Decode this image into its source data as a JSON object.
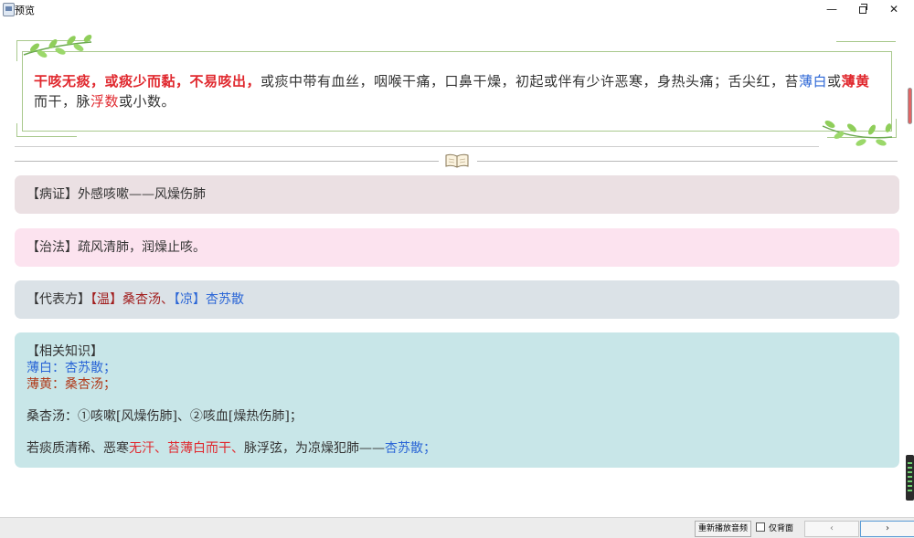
{
  "window": {
    "title": "预览",
    "minimize_glyph": "—",
    "close_glyph": "✕"
  },
  "symptoms": {
    "seg1": "干咳无痰，或痰少而黏，不易咳出，",
    "seg2": "或痰中带有血丝，咽喉干痛，口鼻干燥，初起或伴有少许恶寒，身热头痛；舌尖红，苔",
    "seg3": "薄白",
    "seg4": "或",
    "seg5": "薄黄",
    "seg6": "而干，脉",
    "seg7": "浮数",
    "seg8": "或小数。"
  },
  "sections": {
    "syndrome": "【病证】外感咳嗽——风燥伤肺",
    "treatment": "【治法】疏风清肺，润燥止咳。",
    "formula": {
      "label": "【代表方】",
      "warm_tag": "【温】",
      "warm_formula": "桑杏汤、",
      "cool_tag": "【凉】",
      "cool_formula": "杏苏散"
    },
    "knowledge": {
      "title": "【相关知识】",
      "line1": "薄白：杏苏散；",
      "line2": "薄黄：桑杏汤；",
      "line3": "桑杏汤：①咳嗽[风燥伤肺]、②咳血[燥热伤肺]；",
      "line4_a": "若痰质清稀、恶寒",
      "line4_b": "无汗、苔薄白而干、",
      "line4_c": "脉浮弦，为凉燥犯肺——",
      "line4_d": "杏苏散；"
    }
  },
  "bottom": {
    "replay_button": "重新播放音频",
    "back_only_label": "仅背面",
    "prev_glyph": "‹",
    "next_glyph": "›"
  },
  "colors": {
    "red": "#e0282e",
    "blue": "#2b66d6",
    "dark_red": "#a11d1d",
    "syndrome_bg": "#ebe0e3",
    "treatment_bg": "#fce3ef",
    "formula_bg": "#dbe2e7",
    "knowledge_bg": "#c8e6e8"
  },
  "icons": [
    "app-icon",
    "leaf-decoration-icon",
    "open-book-icon",
    "audio-level-icon"
  ]
}
